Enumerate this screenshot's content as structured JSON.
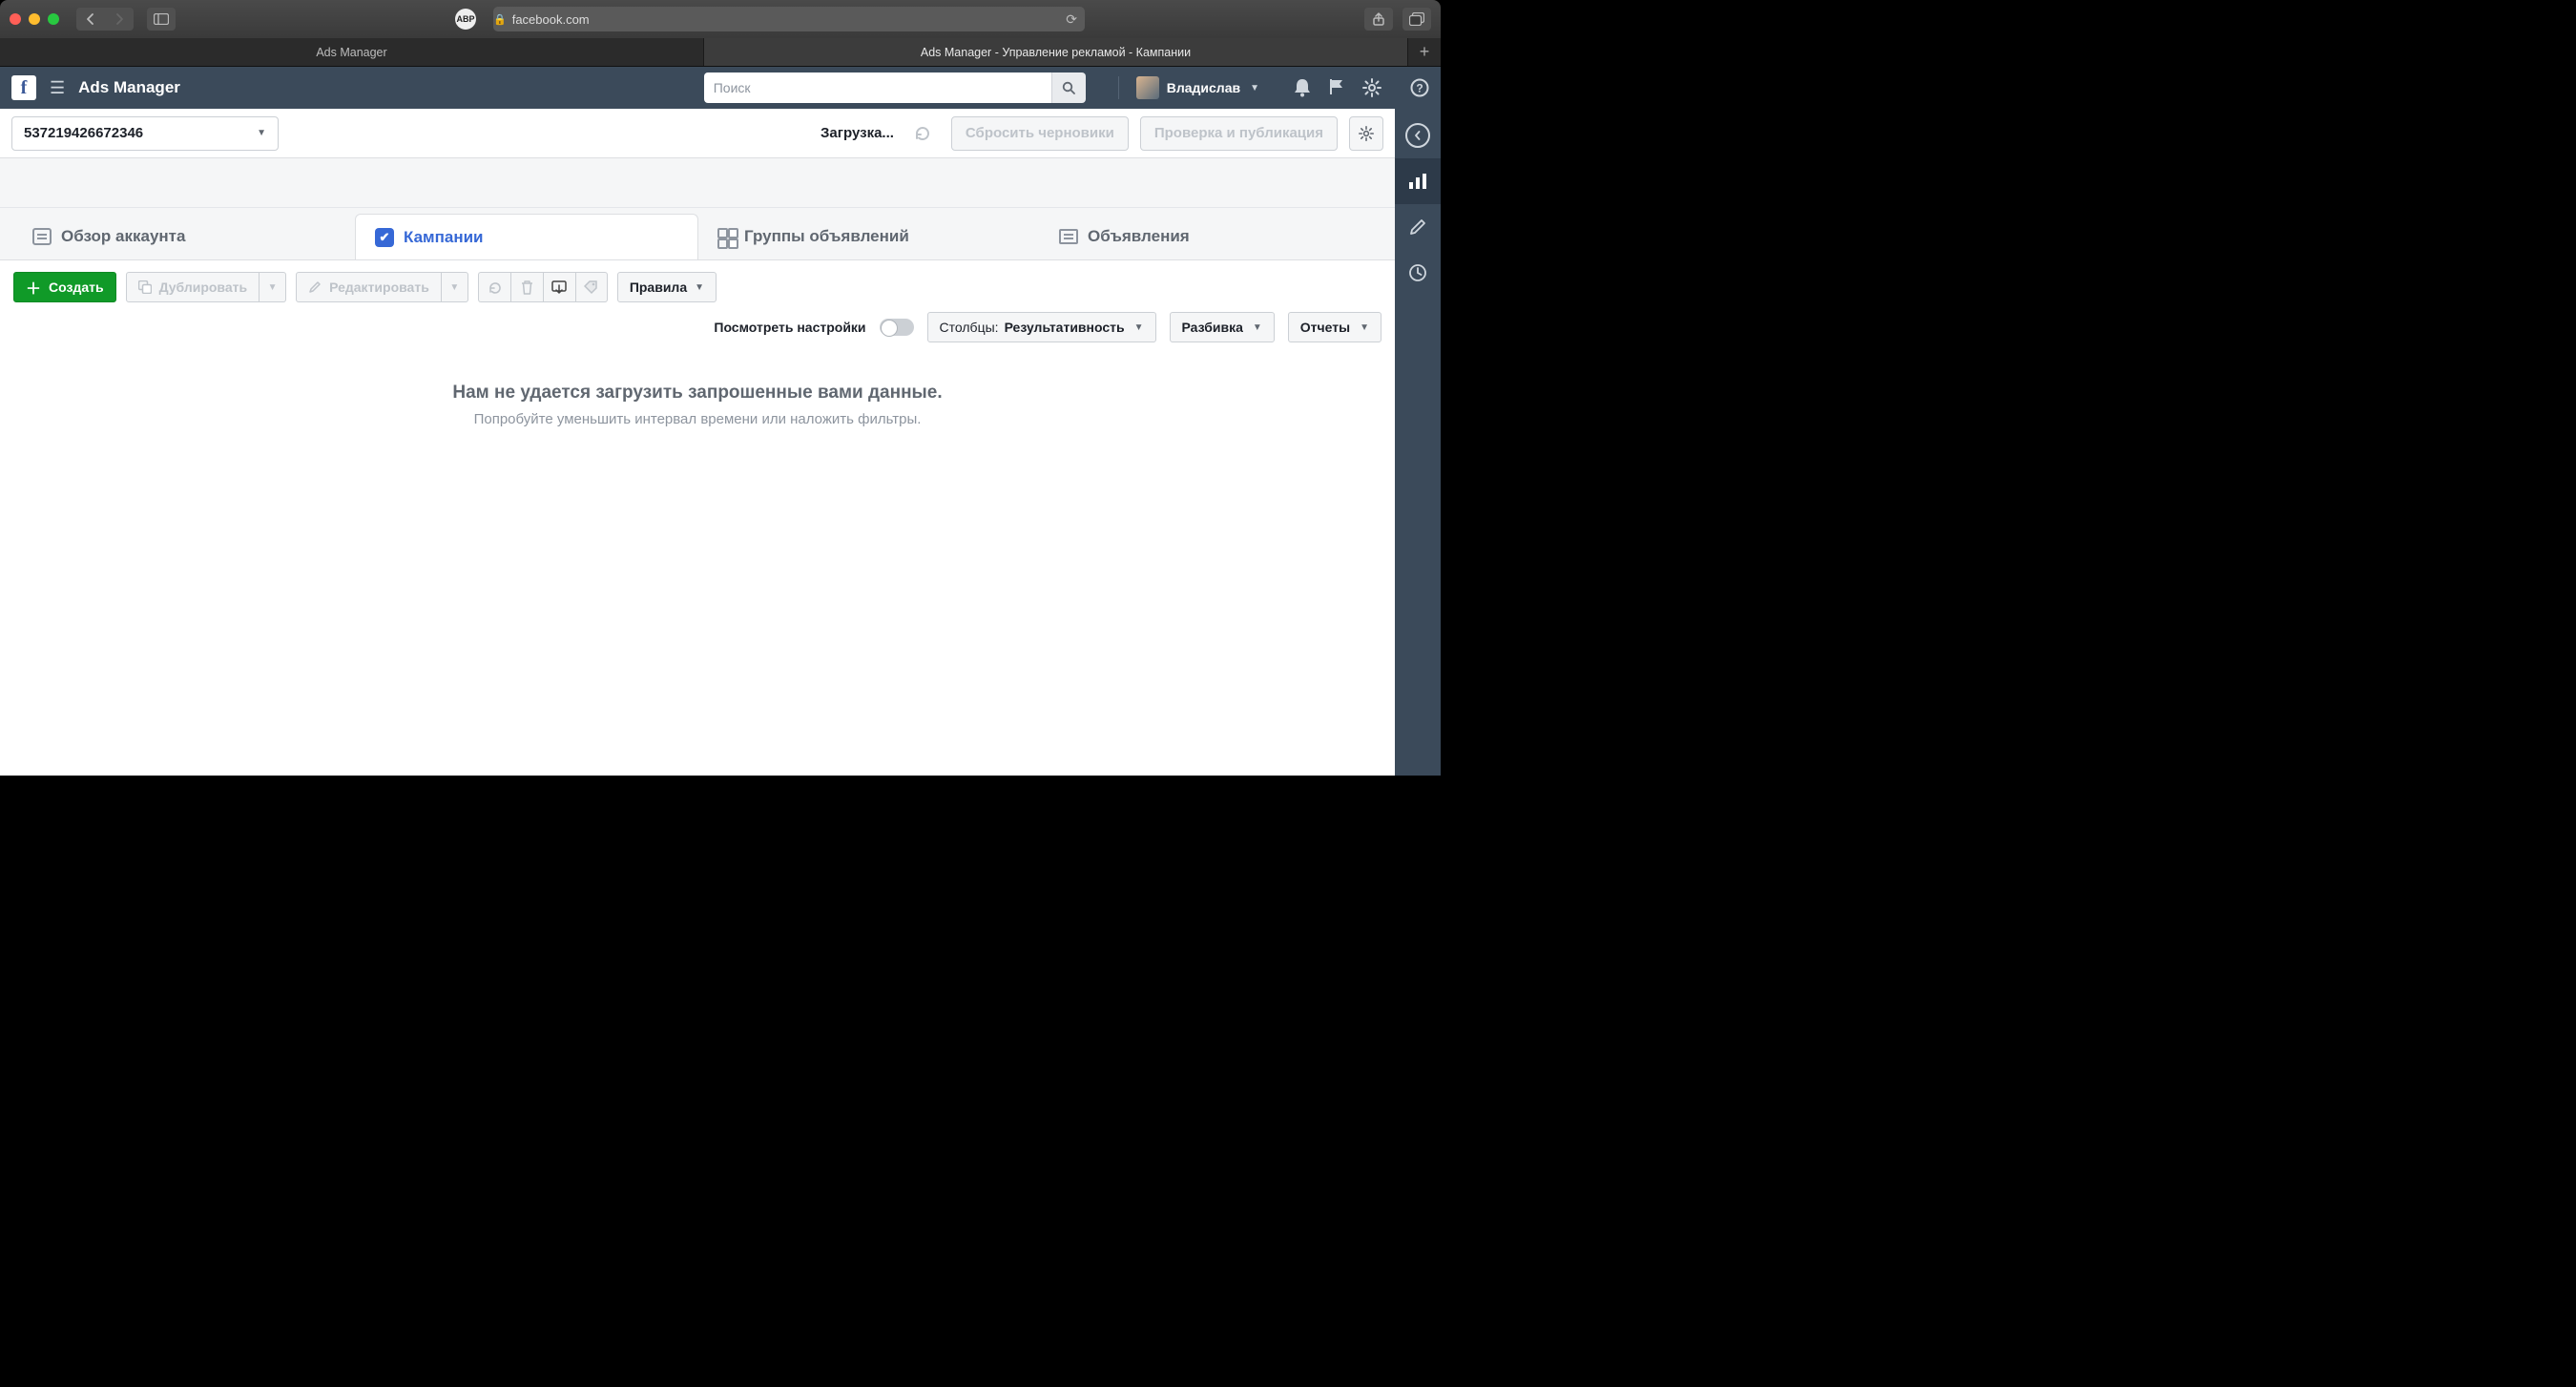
{
  "browser": {
    "url": "facebook.com",
    "tabs": [
      {
        "title": "Ads Manager",
        "active": false
      },
      {
        "title": "Ads Manager - Управление рекламой - Кампании",
        "active": true
      }
    ]
  },
  "header": {
    "product": "Ads Manager",
    "search_placeholder": "Поиск",
    "user_name": "Владислав"
  },
  "account_bar": {
    "account_id": "537219426672346",
    "loading": "Загрузка...",
    "reset_drafts": "Сбросить черновики",
    "review_publish": "Проверка и публикация"
  },
  "tabs": {
    "overview": "Обзор аккаунта",
    "campaigns": "Кампании",
    "adsets": "Группы объявлений",
    "ads": "Объявления"
  },
  "toolbar": {
    "create": "Создать",
    "duplicate": "Дублировать",
    "edit": "Редактировать",
    "rules": "Правила",
    "view_settings": "Посмотреть настройки",
    "columns_label": "Столбцы:",
    "columns_value": "Результативность",
    "breakdown": "Разбивка",
    "reports": "Отчеты"
  },
  "empty": {
    "headline": "Нам не удается загрузить запрошенные вами данные.",
    "hint": "Попробуйте уменьшить интервал времени или наложить фильтры."
  },
  "abp": "ABP"
}
